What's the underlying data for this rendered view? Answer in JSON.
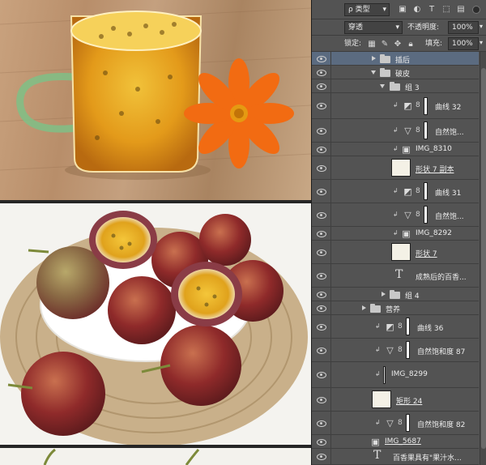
{
  "toolbar": {
    "filter_type": "ρ 类型",
    "blend_mode": "穿透",
    "opacity_label": "不透明度:",
    "opacity_value": "100%",
    "lock_label": "锁定:",
    "fill_label": "填充:",
    "fill_value": "100%"
  },
  "layers": [
    {
      "name": "插后",
      "kind": "group",
      "expanded": false,
      "indent": 0
    },
    {
      "name": "破皮",
      "kind": "group",
      "expanded": true,
      "indent": 0
    },
    {
      "name": "组 3",
      "kind": "group",
      "expanded": true,
      "indent": 1
    },
    {
      "name": "曲线 32",
      "kind": "curves",
      "indent": 2
    },
    {
      "name": "自然饱...",
      "kind": "vibrance",
      "indent": 2
    },
    {
      "name": "IMG_8310",
      "kind": "smart",
      "indent": 2
    },
    {
      "name": "形状 7 副本",
      "kind": "shape",
      "indent": 2
    },
    {
      "name": "曲线 31",
      "kind": "curves",
      "indent": 2
    },
    {
      "name": "自然饱...",
      "kind": "vibrance",
      "indent": 2
    },
    {
      "name": "IMG_8292",
      "kind": "smart",
      "indent": 2
    },
    {
      "name": "形状 7",
      "kind": "shape",
      "indent": 2
    },
    {
      "name": "成熟后的百香...",
      "kind": "text",
      "indent": 2
    },
    {
      "name": "组 4",
      "kind": "group",
      "expanded": false,
      "indent": 1
    },
    {
      "name": "营养",
      "kind": "group",
      "expanded": true,
      "indent": 0
    },
    {
      "name": "曲线 36",
      "kind": "curves",
      "indent": 1
    },
    {
      "name": "自然饱和度 87",
      "kind": "vibrance",
      "indent": 1
    },
    {
      "name": "IMG_8299",
      "kind": "image",
      "indent": 1
    },
    {
      "name": "矩形 24",
      "kind": "shape",
      "indent": 1
    },
    {
      "name": "自然饱和度 82",
      "kind": "vibrance",
      "indent": 1
    },
    {
      "name": "IMG_5687",
      "kind": "smart",
      "indent": 0
    },
    {
      "name": "百香果具有\"果汁水...",
      "kind": "text",
      "indent": 0
    }
  ],
  "icons": {
    "eye": "eye-icon",
    "folder": "folder-icon",
    "curves": "curves-icon",
    "vibrance": "vibrance-icon",
    "text": "text-icon",
    "link": "chain-link-icon"
  },
  "colors": {
    "panel_bg": "#535353",
    "selected_row": "#5b6b80",
    "canvas_bg": "#262626",
    "flower": "#f26b12",
    "juice": "#e7a21b",
    "fruit_skin": "#8f2a2a"
  }
}
